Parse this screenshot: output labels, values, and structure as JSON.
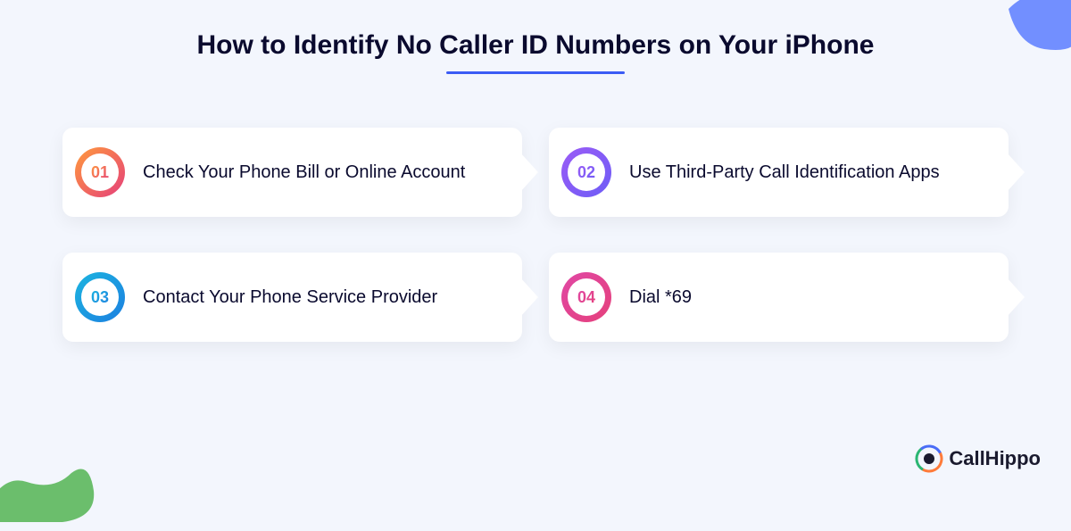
{
  "title": "How to Identify No Caller ID Numbers on Your iPhone",
  "items": [
    {
      "num": "01",
      "label": "Check Your Phone Bill or Online Account"
    },
    {
      "num": "02",
      "label": "Use Third-Party Call Identification Apps"
    },
    {
      "num": "03",
      "label": "Contact Your Phone Service Provider"
    },
    {
      "num": "04",
      "label": "Dial *69"
    }
  ],
  "logo": {
    "text": "CallHippo"
  }
}
